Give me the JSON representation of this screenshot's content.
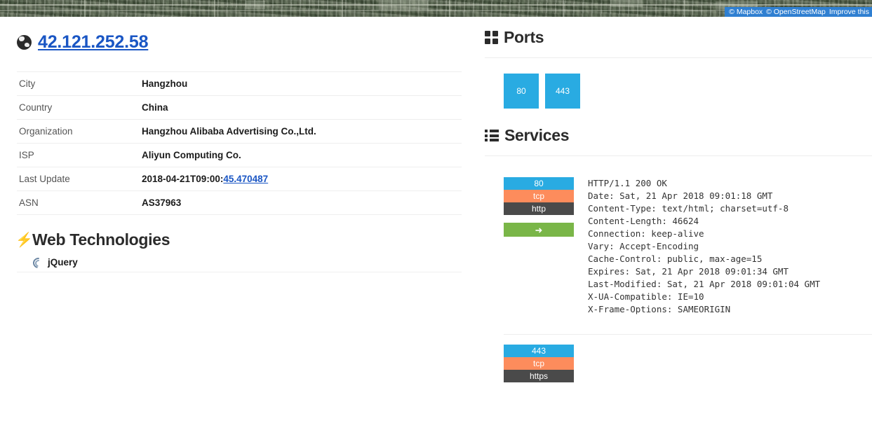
{
  "map": {
    "attribution": {
      "mapbox": "© Mapbox",
      "osm": "© OpenStreetMap",
      "improve": "Improve this"
    }
  },
  "host": {
    "ip": "42.121.252.58",
    "globe_icon": "globe-icon"
  },
  "details": {
    "rows": [
      {
        "key": "City",
        "value": "Hangzhou"
      },
      {
        "key": "Country",
        "value": "China"
      },
      {
        "key": "Organization",
        "value": "Hangzhou Alibaba Advertising Co.,Ltd."
      },
      {
        "key": "ISP",
        "value": "Aliyun Computing Co."
      },
      {
        "key": "Last Update",
        "value": "2018-04-21T09:00:",
        "link": "45.470487"
      },
      {
        "key": "ASN",
        "value": "AS37963"
      }
    ]
  },
  "web_technologies": {
    "title": "Web Technologies",
    "icon": "bolt-icon",
    "items": [
      {
        "label": "jQuery",
        "icon": "jquery-icon"
      }
    ]
  },
  "ports": {
    "title": "Ports",
    "icon": "grid-icon",
    "items": [
      {
        "port": "80"
      },
      {
        "port": "443"
      }
    ]
  },
  "services": {
    "title": "Services",
    "icon": "list-icon",
    "items": [
      {
        "port": "80",
        "protocol": "tcp",
        "name": "http",
        "has_button": true,
        "button_icon": "arrow-right-icon",
        "button_glyph": "➜",
        "banner": "HTTP/1.1 200 OK\nDate: Sat, 21 Apr 2018 09:01:18 GMT\nContent-Type: text/html; charset=utf-8\nContent-Length: 46624\nConnection: keep-alive\nVary: Accept-Encoding\nCache-Control: public, max-age=15\nExpires: Sat, 21 Apr 2018 09:01:34 GMT\nLast-Modified: Sat, 21 Apr 2018 09:01:04 GMT\nX-UA-Compatible: IE=10\nX-Frame-Options: SAMEORIGIN"
      },
      {
        "port": "443",
        "protocol": "tcp",
        "name": "https",
        "has_button": false,
        "banner": ""
      }
    ]
  },
  "colors": {
    "port_blue": "#29abe2",
    "proto_orange": "#fd8c5c",
    "service_dark": "#4a4a4a",
    "button_green": "#7ab648",
    "link_blue": "#1a56c4",
    "attrib_blue": "#2f7fd1"
  }
}
